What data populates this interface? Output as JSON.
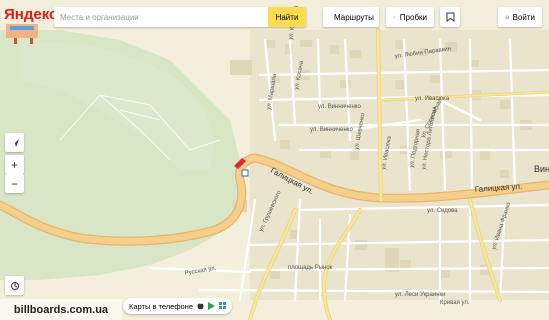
{
  "header": {
    "logo_text": "Яндекс",
    "search_placeholder": "Места и организации",
    "search_button": "Найти",
    "routes_label": "Маршруты",
    "traffic_label": "Пробки",
    "login_label": "Войти"
  },
  "map": {
    "streets": {
      "galitskaya": "Галицкая ул.",
      "galitskaya_right": "Галицкая ул.",
      "vinnichenko": "ул. Винниченко",
      "vinnichenko2": "ул. Винниченко",
      "ivasyuka": "ул. Ивасюка",
      "ivasyuka2": "ул. Ивасюка",
      "franko": "ул. Ивана Франко",
      "sedova": "ул. Седова",
      "kruchovaya": "ул. Круговая",
      "lesi": "ул. Леси Украинки",
      "shevchenko": "ул. Шевченко",
      "russkaya": "Русская ул.",
      "kozlovskaya": "ул. Сосновская",
      "lyubin": "ул. Любин Паравкин",
      "nesterov": "ул. Нестора Летописца",
      "podgorna": "ул. Подгорная",
      "grushevskogo": "ул. Грушевского",
      "marshal": "ул. Маршала",
      "kosach": "ул. Косача",
      "ploshad": "площадь Рынок",
      "kryshevaya": "Кривая ул."
    },
    "poi": "Вин"
  },
  "tools": {
    "compass_icon": "compass-icon",
    "zoom_in": "+",
    "zoom_out": "−"
  },
  "footer": {
    "phone_label": "Карты в телефоне",
    "watermark": "billboards.com.ua"
  }
}
